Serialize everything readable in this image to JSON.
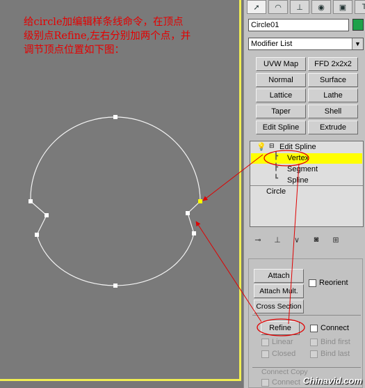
{
  "annotation": {
    "lines": [
      "给circle加编辑样条线命令，在顶点",
      "级别点Refine,左右分别加两个点，并",
      "调节顶点位置如下图："
    ]
  },
  "command_panel": {
    "tabs": [
      {
        "icon": "create-icon",
        "glyph": "➚"
      },
      {
        "icon": "modify-icon",
        "glyph": "◠"
      },
      {
        "icon": "hierarchy-icon",
        "glyph": "⊥"
      },
      {
        "icon": "motion-icon",
        "glyph": "◉"
      },
      {
        "icon": "display-icon",
        "glyph": "▣"
      },
      {
        "icon": "utilities-icon",
        "glyph": "T"
      }
    ],
    "object_name": "Circle01",
    "object_color": "#1ea14a",
    "modifier_list": "Modifier List",
    "modifier_buttons": [
      "UVW Map",
      "FFD 2x2x2",
      "Normal",
      "Surface",
      "Lattice",
      "Lathe",
      "Taper",
      "Shell",
      "Edit Spline",
      "Extrude"
    ],
    "stack": {
      "modifier": "Edit Spline",
      "sub_levels": [
        "Vertex",
        "Segment",
        "Spline"
      ],
      "selected": "Vertex",
      "base": "Circle"
    },
    "stack_tools": [
      "pin-stack-icon",
      "show-end-result-icon",
      "make-unique-icon",
      "remove-modifier-icon",
      "configure-sets-icon"
    ],
    "geometry": {
      "attach": "Attach",
      "attach_mult": "Attach Mult.",
      "reorient": "Reorient",
      "cross_section": "Cross Section",
      "refine": "Refine",
      "connect": "Connect",
      "linear": "Linear",
      "bind_first": "Bind first",
      "closed": "Closed",
      "bind_last": "Bind last",
      "connect_copy_group": "Connect Copy",
      "connect_copy": "Connect"
    }
  },
  "watermark": "Chinavid.com"
}
